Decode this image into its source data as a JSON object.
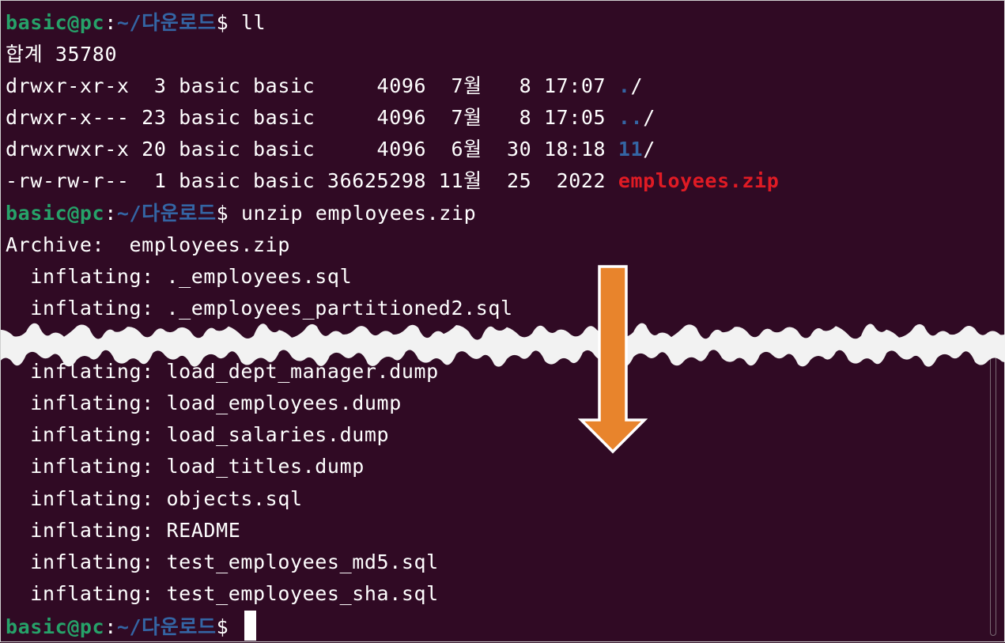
{
  "prompt": {
    "user": "basic@pc",
    "colon": ":",
    "path": "~/다운로드",
    "symbol": "$"
  },
  "commands": {
    "ll": " ll",
    "unzip": " unzip employees.zip",
    "final": " "
  },
  "ll_output": {
    "total": "합계 35780",
    "rows": [
      {
        "meta": "drwxr-xr-x  3 basic basic     4096  7월   8 17:07 ",
        "name": ".",
        "suffix": "/",
        "kind": "dir"
      },
      {
        "meta": "drwxr-x--- 23 basic basic     4096  7월   8 17:05 ",
        "name": "..",
        "suffix": "/",
        "kind": "dir"
      },
      {
        "meta": "drwxrwxr-x 20 basic basic     4096  6월  30 18:18 ",
        "name": "11",
        "suffix": "/",
        "kind": "dir"
      },
      {
        "meta": "-rw-rw-r--  1 basic basic 36625298 11월  25  2022 ",
        "name": "employees.zip",
        "suffix": "",
        "kind": "archive"
      }
    ]
  },
  "unzip_output": {
    "archive_line": "Archive:  employees.zip",
    "before_break": [
      "  inflating: ._employees.sql",
      "  inflating: ._employees_partitioned2.sql"
    ],
    "after_break": [
      "  inflating: load_dept_manager.dump",
      "  inflating: load_employees.dump",
      "  inflating: load_salaries.dump",
      "  inflating: load_titles.dump",
      "  inflating: objects.sql",
      "  inflating: README",
      "  inflating: test_employees_md5.sql",
      "  inflating: test_employees_sha.sql"
    ]
  },
  "colors": {
    "background": "#300a24",
    "prompt_user": "#26a269",
    "prompt_path": "#3465a4",
    "archive_file": "#e01b24",
    "arrow_fill": "#e8842c",
    "tear_fill": "#f2f2f2"
  },
  "icons": {
    "arrow": "down-arrow-icon"
  }
}
